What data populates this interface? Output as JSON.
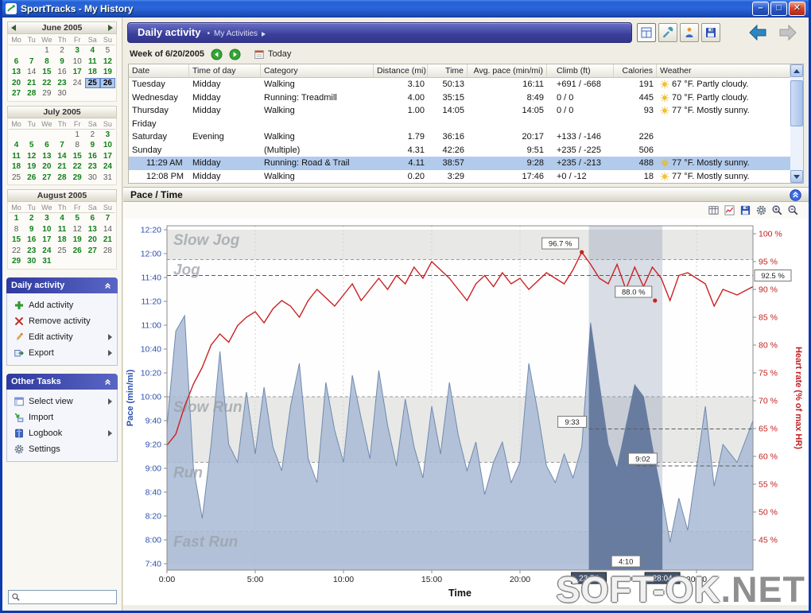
{
  "window": {
    "title": "SportTracks - My History",
    "buttons": [
      "minimize",
      "maximize",
      "close"
    ]
  },
  "search": {
    "value": "",
    "icon": "search-icon"
  },
  "calendars": {
    "day_headers": [
      "Mo",
      "Tu",
      "We",
      "Th",
      "Fr",
      "Sa",
      "Su"
    ],
    "months": [
      {
        "name": "June 2005",
        "nav_arrows": true,
        "weeks": [
          [
            "",
            "",
            "1",
            "2",
            "3g",
            "4g",
            "5"
          ],
          [
            "6g",
            "7g",
            "8g",
            "9g",
            "10",
            "11g",
            "12g"
          ],
          [
            "13g",
            "14",
            "15g",
            "16",
            "17g",
            "18g",
            "19g"
          ],
          [
            "20g",
            "21g",
            "22g",
            "23g",
            "24",
            "25s",
            "26s"
          ],
          [
            "27g",
            "28g",
            "29",
            "30",
            "",
            "",
            ""
          ]
        ]
      },
      {
        "name": "July 2005",
        "nav_arrows": false,
        "weeks": [
          [
            "",
            "",
            "",
            "",
            "1",
            "2",
            "3g"
          ],
          [
            "4g",
            "5g",
            "6g",
            "7g",
            "8",
            "9g",
            "10g"
          ],
          [
            "11g",
            "12g",
            "13g",
            "14g",
            "15g",
            "16g",
            "17g"
          ],
          [
            "18g",
            "19g",
            "20g",
            "21g",
            "22g",
            "23g",
            "24g"
          ],
          [
            "25",
            "26g",
            "27g",
            "28g",
            "29g",
            "30",
            "31"
          ]
        ]
      },
      {
        "name": "August 2005",
        "nav_arrows": false,
        "weeks": [
          [
            "1g",
            "2g",
            "3g",
            "4g",
            "5g",
            "6g",
            "7g"
          ],
          [
            "8",
            "9g",
            "10g",
            "11g",
            "12",
            "13g",
            "14"
          ],
          [
            "15g",
            "16g",
            "17g",
            "18g",
            "19g",
            "20g",
            "21g"
          ],
          [
            "22",
            "23g",
            "24g",
            "25",
            "26g",
            "27g",
            "28"
          ],
          [
            "29g",
            "30g",
            "31g",
            "",
            "",
            "",
            ""
          ]
        ]
      }
    ]
  },
  "sidebar": {
    "panels": [
      {
        "title": "Daily activity",
        "collapse_icon": "panel-chevron-icon",
        "items": [
          {
            "label": "Add activity",
            "icon": "add-icon",
            "submenu": false
          },
          {
            "label": "Remove activity",
            "icon": "remove-icon",
            "submenu": false
          },
          {
            "label": "Edit activity",
            "icon": "edit-icon",
            "submenu": true
          },
          {
            "label": "Export",
            "icon": "export-icon",
            "submenu": true
          }
        ]
      },
      {
        "title": "Other Tasks",
        "collapse_icon": "panel-chevron-icon",
        "items": [
          {
            "label": "Select view",
            "icon": "select-view-icon",
            "submenu": true
          },
          {
            "label": "Import",
            "icon": "import-icon",
            "submenu": false
          },
          {
            "label": "Logbook",
            "icon": "logbook-icon",
            "submenu": true
          },
          {
            "label": "Settings",
            "icon": "gear-icon",
            "submenu": false
          }
        ]
      }
    ]
  },
  "header": {
    "title": "Daily activity",
    "bullet": "•",
    "breadcrumb": "My Activities",
    "toolbar_icons": [
      "calendar-view-icon",
      "tools-icon",
      "athlete-icon",
      "save-icon"
    ],
    "nav_icons": [
      "back-arrow-icon",
      "forward-arrow-icon"
    ]
  },
  "week_bar": {
    "label": "Week of 6/20/2005",
    "today": "Today",
    "prev_icon": "prev-week-icon",
    "next_icon": "next-week-icon",
    "today_icon": "calendar-icon"
  },
  "table": {
    "columns": [
      "Date",
      "Time of day",
      "Category",
      "Distance (mi)",
      "Time",
      "Avg. pace (min/mi)",
      "Climb (ft)",
      "Calories",
      "Weather"
    ],
    "rows": [
      {
        "date": "Tuesday",
        "time_of_day": "Midday",
        "category": "Walking",
        "distance": "3.10",
        "time": "50:13",
        "avg_pace": "16:11",
        "climb": "+691 / -668",
        "calories": "191",
        "weather": "67 °F. Partly cloudy.",
        "weather_icon": "sun-icon",
        "indent": false,
        "selected": false
      },
      {
        "date": "Wednesday",
        "time_of_day": "Midday",
        "category": "Running: Treadmill",
        "distance": "4.00",
        "time": "35:15",
        "avg_pace": "8:49",
        "climb": "0 / 0",
        "calories": "445",
        "weather": "70 °F. Partly cloudy.",
        "weather_icon": "sun-icon",
        "indent": false,
        "selected": false
      },
      {
        "date": "Thursday",
        "time_of_day": "Midday",
        "category": "Walking",
        "distance": "1.00",
        "time": "14:05",
        "avg_pace": "14:05",
        "climb": "0 / 0",
        "calories": "93",
        "weather": "77 °F. Mostly sunny.",
        "weather_icon": "sun-icon",
        "indent": false,
        "selected": false
      },
      {
        "date": "Friday",
        "time_of_day": "",
        "category": "",
        "distance": "",
        "time": "",
        "avg_pace": "",
        "climb": "",
        "calories": "",
        "weather": "",
        "weather_icon": "",
        "indent": false,
        "selected": false
      },
      {
        "date": "Saturday",
        "time_of_day": "Evening",
        "category": "Walking",
        "distance": "1.79",
        "time": "36:16",
        "avg_pace": "20:17",
        "climb": "+133 / -146",
        "calories": "226",
        "weather": "",
        "weather_icon": "",
        "indent": false,
        "selected": false
      },
      {
        "date": "Sunday",
        "time_of_day": "",
        "category": "(Multiple)",
        "distance": "4.31",
        "time": "42:26",
        "avg_pace": "9:51",
        "climb": "+235 / -225",
        "calories": "506",
        "weather": "",
        "weather_icon": "",
        "indent": false,
        "selected": false
      },
      {
        "date": "11:29 AM",
        "time_of_day": "Midday",
        "category": "Running: Road & Trail",
        "distance": "4.11",
        "time": "38:57",
        "avg_pace": "9:28",
        "climb": "+235 / -213",
        "calories": "488",
        "weather": "77 °F. Mostly sunny.",
        "weather_icon": "sun-icon",
        "indent": true,
        "selected": true
      },
      {
        "date": "12:08 PM",
        "time_of_day": "Midday",
        "category": "Walking",
        "distance": "0.20",
        "time": "3:29",
        "avg_pace": "17:46",
        "climb": "+0 / -12",
        "calories": "18",
        "weather": "77 °F. Mostly sunny.",
        "weather_icon": "sun-icon",
        "indent": true,
        "selected": false
      }
    ]
  },
  "chart": {
    "title": "Pace / Time",
    "collapse_icon": "collapse-chart-icon",
    "toolbar_icons": [
      "table-icon",
      "line-chart-icon",
      "save-icon",
      "gear-icon",
      "zoom-in-icon",
      "zoom-out-icon"
    ]
  },
  "chart_data": {
    "type": "area+line",
    "title": "Pace / Time",
    "xlabel": "Time",
    "x_ticks": [
      "0:00",
      "5:00",
      "10:00",
      "15:00",
      "20:00",
      "30:00"
    ],
    "left_axis": {
      "label": "Pace (min/mi)",
      "color": "#2b4fae",
      "ticks": [
        "12:20",
        "12:00",
        "11:40",
        "11:20",
        "11:00",
        "10:40",
        "10:20",
        "10:00",
        "9:40",
        "9:20",
        "9:00",
        "8:40",
        "8:20",
        "8:00",
        "7:40"
      ]
    },
    "right_axis": {
      "label": "Heart rate (% of max HR)",
      "color": "#c22020",
      "ticks": [
        "100 %",
        "95 %",
        "90 %",
        "85 %",
        "80 %",
        "75 %",
        "70 %",
        "65 %",
        "60 %",
        "55 %",
        "50 %",
        "45 %"
      ]
    },
    "zones": [
      {
        "label": "Slow Jog",
        "from_pace": "11:55",
        "to_pace": "12:20"
      },
      {
        "label": "Jog",
        "from_pace": "10:00",
        "to_pace": "11:55"
      },
      {
        "label": "Slow Run",
        "from_pace": "9:05",
        "to_pace": "10:00"
      },
      {
        "label": "Run",
        "from_pace": "8:07",
        "to_pace": "9:05"
      },
      {
        "label": "Fast Run",
        "from_pace": "7:40",
        "to_pace": "8:07"
      }
    ],
    "selection": {
      "start": "23:54",
      "end": "28:04",
      "duration": "4:10"
    },
    "marker_lines": [
      {
        "axis": "hr",
        "value": 92.5,
        "from_t": 0,
        "to_t": 34
      },
      {
        "axis": "pace",
        "value": "9:33",
        "from_t": 23.9,
        "to_t": 34
      },
      {
        "axis": "pace",
        "value": "9:02",
        "from_t": 26.6,
        "to_t": 34
      }
    ],
    "callouts": [
      {
        "label": "96.7 %",
        "t": 23.5,
        "hr": 96.7
      },
      {
        "label": "92.5 %",
        "hr": 92.5,
        "at_right_edge": true
      },
      {
        "label": "88.0 %",
        "t": 27.65,
        "hr": 88.0
      },
      {
        "label": "9:33",
        "t": 23.9,
        "pace": "9:33"
      },
      {
        "label": "9:02",
        "t": 27.9,
        "pace": "9:02"
      },
      {
        "label": "4:10",
        "t": 26.0,
        "at_axis": true
      }
    ],
    "x_min": [
      0,
      0.5,
      1,
      1.5,
      2,
      2.5,
      3,
      3.5,
      4,
      4.5,
      5,
      5.5,
      6,
      6.5,
      7,
      7.5,
      8,
      8.5,
      9,
      9.5,
      10,
      10.5,
      11,
      11.5,
      12,
      12.5,
      13,
      13.5,
      14,
      14.5,
      15,
      15.5,
      16,
      16.5,
      17,
      17.5,
      18,
      18.5,
      19,
      19.5,
      20,
      20.5,
      21,
      21.5,
      22,
      22.5,
      23,
      23.5,
      24,
      24.5,
      25,
      25.5,
      26,
      26.5,
      27,
      27.5,
      28,
      28.5,
      29,
      29.5,
      30,
      30.5,
      31,
      31.5,
      32.3,
      33.2
    ],
    "series": [
      {
        "name": "Pace",
        "type": "area",
        "axis": "pace",
        "values_sec": [
          575,
          655,
          668,
          540,
          498,
          560,
          638,
          560,
          545,
          604,
          552,
          608,
          558,
          538,
          592,
          628,
          548,
          528,
          612,
          572,
          545,
          618,
          582,
          548,
          622,
          576,
          542,
          598,
          558,
          532,
          592,
          552,
          612,
          568,
          538,
          562,
          518,
          545,
          562,
          528,
          545,
          628,
          588,
          542,
          528,
          552,
          532,
          558,
          662,
          610,
          560,
          540,
          575,
          610,
          600,
          558,
          520,
          478,
          515,
          488,
          540,
          592,
          525,
          560,
          545,
          580
        ]
      },
      {
        "name": "Heart rate",
        "type": "line",
        "axis": "hr",
        "values_pct": [
          62,
          64,
          69,
          73,
          76,
          80,
          82,
          80.5,
          83.5,
          85,
          86,
          84,
          86.5,
          88,
          87,
          85,
          88,
          90,
          88.5,
          87,
          89,
          91,
          88,
          90,
          92,
          90,
          92.5,
          91,
          94,
          92,
          95,
          93.5,
          92,
          90,
          88,
          91,
          92.5,
          90.5,
          93,
          91,
          92,
          90,
          91.5,
          93,
          92,
          91,
          93.5,
          96.7,
          94.5,
          92,
          91,
          94.5,
          90,
          94,
          90.5,
          94,
          92,
          88,
          92.5,
          93,
          92,
          91,
          87,
          90,
          89,
          90.5
        ]
      }
    ]
  },
  "watermark": {
    "part1": "SOFT-OK",
    "part2": ".NET"
  }
}
